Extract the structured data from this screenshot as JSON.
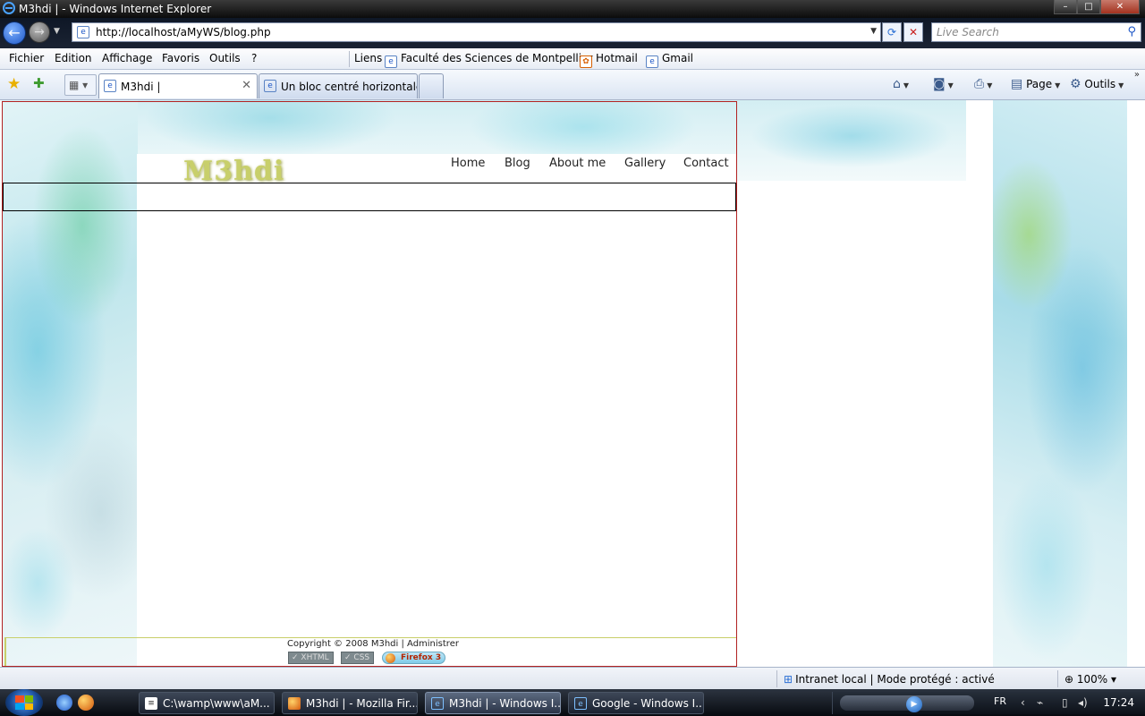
{
  "window": {
    "title": "M3hdi | - Windows Internet Explorer",
    "minimize": "–",
    "maximize": "□",
    "close": "✕"
  },
  "address_bar": {
    "url": "http://localhost/aMyWS/blog.php",
    "search_placeholder": "Live Search"
  },
  "menu": {
    "items": [
      "Fichier",
      "Edition",
      "Affichage",
      "Favoris",
      "Outils",
      "?"
    ]
  },
  "links_bar": {
    "label": "Liens",
    "items": [
      "Faculté des Sciences de Montpellier",
      "Hotmail",
      "Gmail"
    ]
  },
  "tabs": [
    {
      "title": "M3hdi |",
      "active": true
    },
    {
      "title": "Un bloc centré horizontale...",
      "active": false
    }
  ],
  "command_bar": {
    "page": "Page",
    "tools": "Outils"
  },
  "page": {
    "logo": "M3hdi",
    "nav": [
      "Home",
      "Blog",
      "About me",
      "Gallery",
      "Contact"
    ],
    "footer": {
      "copyright": "Copyright © 2008 M3hdi | Administrer",
      "badges": [
        "XHTML",
        "CSS",
        "Firefox 3"
      ]
    }
  },
  "status_bar": {
    "zone": "Intranet local | Mode protégé : activé",
    "zoom": "100%"
  },
  "taskbar": {
    "tasks": [
      {
        "label": "C:\\wamp\\www\\aM...",
        "active": false
      },
      {
        "label": "M3hdi | - Mozilla Fir...",
        "active": false
      },
      {
        "label": "M3hdi | - Windows I...",
        "active": true
      },
      {
        "label": "Google - Windows I...",
        "active": false
      }
    ],
    "language": "FR",
    "clock": "17:24"
  },
  "colors": {
    "frame_border": "#b22222",
    "logo": "#c8cf6a",
    "ie_blue": "#1c56c7"
  }
}
